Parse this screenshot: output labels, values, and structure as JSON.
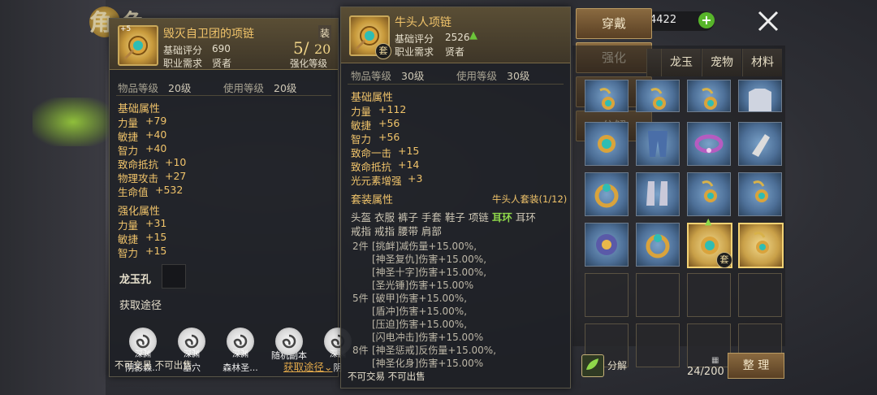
{
  "background": {
    "title": "角色",
    "currency": "4422"
  },
  "left_panel": {
    "plus_level": "+5",
    "item_name": "毁灭自卫团的项链",
    "equip_tag": "装",
    "score_label": "基础评分",
    "score": "690",
    "job_label": "职业需求",
    "job": "贤者",
    "enhance_current": "5/",
    "enhance_max": "20",
    "enhance_label": "强化等级",
    "item_level_label": "物品等级",
    "item_level": "20级",
    "use_level_label": "使用等级",
    "use_level": "20级",
    "base_attr_title": "基础属性",
    "base_attrs": [
      {
        "name": "力量",
        "value": "+79"
      },
      {
        "name": "敏捷",
        "value": "+40"
      },
      {
        "name": "智力",
        "value": "+40"
      },
      {
        "name": "致命抵抗",
        "value": "+10"
      },
      {
        "name": "物理攻击",
        "value": "+27"
      },
      {
        "name": "生命值",
        "value": "+532"
      }
    ],
    "enh_attr_title": "强化属性",
    "enh_attrs": [
      {
        "name": "力量",
        "value": "+31"
      },
      {
        "name": "敏捷",
        "value": "+15"
      },
      {
        "name": "智力",
        "value": "+15"
      }
    ],
    "jade_slot_label": "龙玉孔",
    "obtain_title": "获取途径",
    "sources": [
      {
        "top": "深渊",
        "name": "阴影森..."
      },
      {
        "top": "深渊",
        "name": "墓穴"
      },
      {
        "top": "深渊",
        "name": "森林圣..."
      },
      {
        "top": "",
        "name": "随机副本"
      },
      {
        "top": "深渊",
        "name": "阴"
      }
    ],
    "trade_text": "不可交易 不可出售",
    "obtain_link": "获取途径"
  },
  "mid_panel": {
    "item_name": "牛头人项链",
    "set_tag": "套",
    "score_label": "基础评分",
    "score": "2526",
    "job_label": "职业需求",
    "job": "贤者",
    "item_level_label": "物品等级",
    "item_level": "30级",
    "use_level_label": "使用等级",
    "use_level": "30级",
    "base_attr_title": "基础属性",
    "base_attrs": [
      {
        "name": "力量",
        "value": "+112"
      },
      {
        "name": "敏捷",
        "value": "+56"
      },
      {
        "name": "智力",
        "value": "+56"
      },
      {
        "name": "致命一击",
        "value": "+15"
      },
      {
        "name": "致命抵抗",
        "value": "+14"
      },
      {
        "name": "光元素增强",
        "value": "+3"
      }
    ],
    "set_attr_title": "套装属性",
    "set_name": "牛头人套装(1/12)",
    "set_parts_1": "头盔 衣服 裤子 手套 鞋子 项链",
    "set_parts_hl": "耳环",
    "set_parts_1b": "耳环",
    "set_parts_2": "戒指 戒指 腰带 肩部",
    "set_lines": [
      {
        "prefix": "2件",
        "skill": "[挑衅]",
        "effect": "减伤量",
        "value": "+15.00%,"
      },
      {
        "prefix": "",
        "skill": "[神圣复仇]",
        "effect": "伤害",
        "value": "+15.00%,"
      },
      {
        "prefix": "",
        "skill": "[神圣十字]",
        "effect": "伤害",
        "value": "+15.00%,"
      },
      {
        "prefix": "",
        "skill": "[圣光锤]",
        "effect": "伤害",
        "value": "+15.00%"
      },
      {
        "prefix": "5件",
        "skill": "[破甲]",
        "effect": "伤害",
        "value": "+15.00%,"
      },
      {
        "prefix": "",
        "skill": "[盾冲]",
        "effect": "伤害",
        "value": "+15.00%,"
      },
      {
        "prefix": "",
        "skill": "[压迫]",
        "effect": "伤害",
        "value": "+15.00%,"
      },
      {
        "prefix": "",
        "skill": "[闪电冲击]",
        "effect": "伤害",
        "value": "+15.00%"
      },
      {
        "prefix": "8件",
        "skill": "[神圣惩戒]",
        "effect": "反伤量",
        "value": "+15.00%,"
      },
      {
        "prefix": "",
        "skill": "[神圣化身]",
        "effect": "伤害",
        "value": "+15.00%"
      }
    ],
    "trade_text": "不可交易 不可出售"
  },
  "actions": {
    "wear": "穿戴",
    "enhance": "强化",
    "inlay": "镶嵌",
    "dismantle": "分解"
  },
  "inventory": {
    "tabs": [
      "龙玉",
      "宠物",
      "材料"
    ],
    "dismantle_label": "分解",
    "count": "24/200",
    "sort_button": "整 理",
    "set_badge": "套"
  },
  "colors": {
    "gold": "#f0c36a",
    "green": "#8fd84a",
    "panel": "#1e2026"
  }
}
